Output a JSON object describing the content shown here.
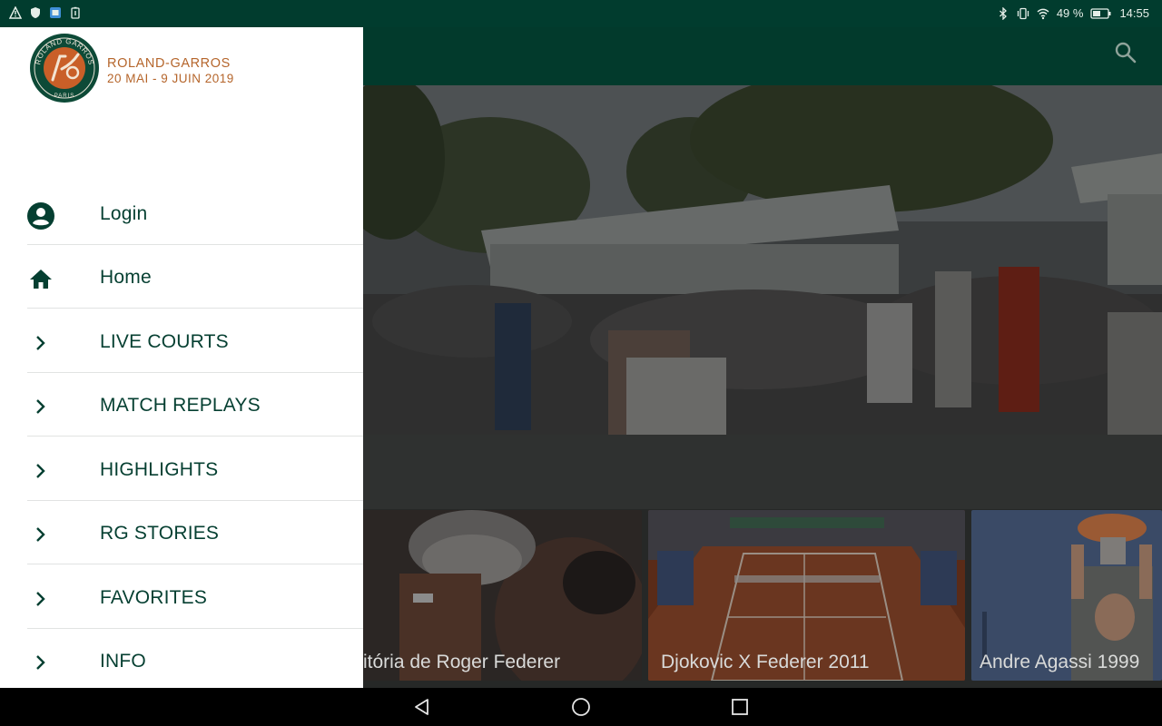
{
  "status_bar": {
    "left_icons": [
      "warning-icon",
      "shield-icon",
      "app-notification-icon",
      "battery-saver-icon"
    ],
    "right_icons": [
      "bluetooth-icon",
      "vibrate-icon",
      "wifi-icon",
      "battery-icon"
    ],
    "battery_percent": "49 %",
    "time": "14:55"
  },
  "app_bar": {
    "search_icon": "search-icon"
  },
  "drawer": {
    "brand_name": "ROLAND-GARROS",
    "brand_dates": "20 MAI - 9 JUIN 2019",
    "logo_text": "ROLAND GARROS · PARIS · RG",
    "items": [
      {
        "label": "Login",
        "icon": "account-icon"
      },
      {
        "label": "Home",
        "icon": "home-icon"
      },
      {
        "label": "LIVE COURTS",
        "icon": "chevron-right-icon"
      },
      {
        "label": "MATCH REPLAYS",
        "icon": "chevron-right-icon"
      },
      {
        "label": "HIGHLIGHTS",
        "icon": "chevron-right-icon"
      },
      {
        "label": "RG STORIES",
        "icon": "chevron-right-icon"
      },
      {
        "label": "FAVORITES",
        "icon": "chevron-right-icon"
      },
      {
        "label": "INFO",
        "icon": "chevron-right-icon"
      }
    ]
  },
  "cards": [
    {
      "title": "itória de Roger Federer"
    },
    {
      "title": "Djokovic X Federer 2011"
    },
    {
      "title": "Andre Agassi 1999"
    }
  ],
  "nav_bar": {
    "buttons": [
      "back-icon",
      "home-circle-icon",
      "recents-icon"
    ]
  },
  "colors": {
    "brand_green": "#023a2c",
    "brand_orange": "#b5652b",
    "clay": "#b9542a"
  }
}
